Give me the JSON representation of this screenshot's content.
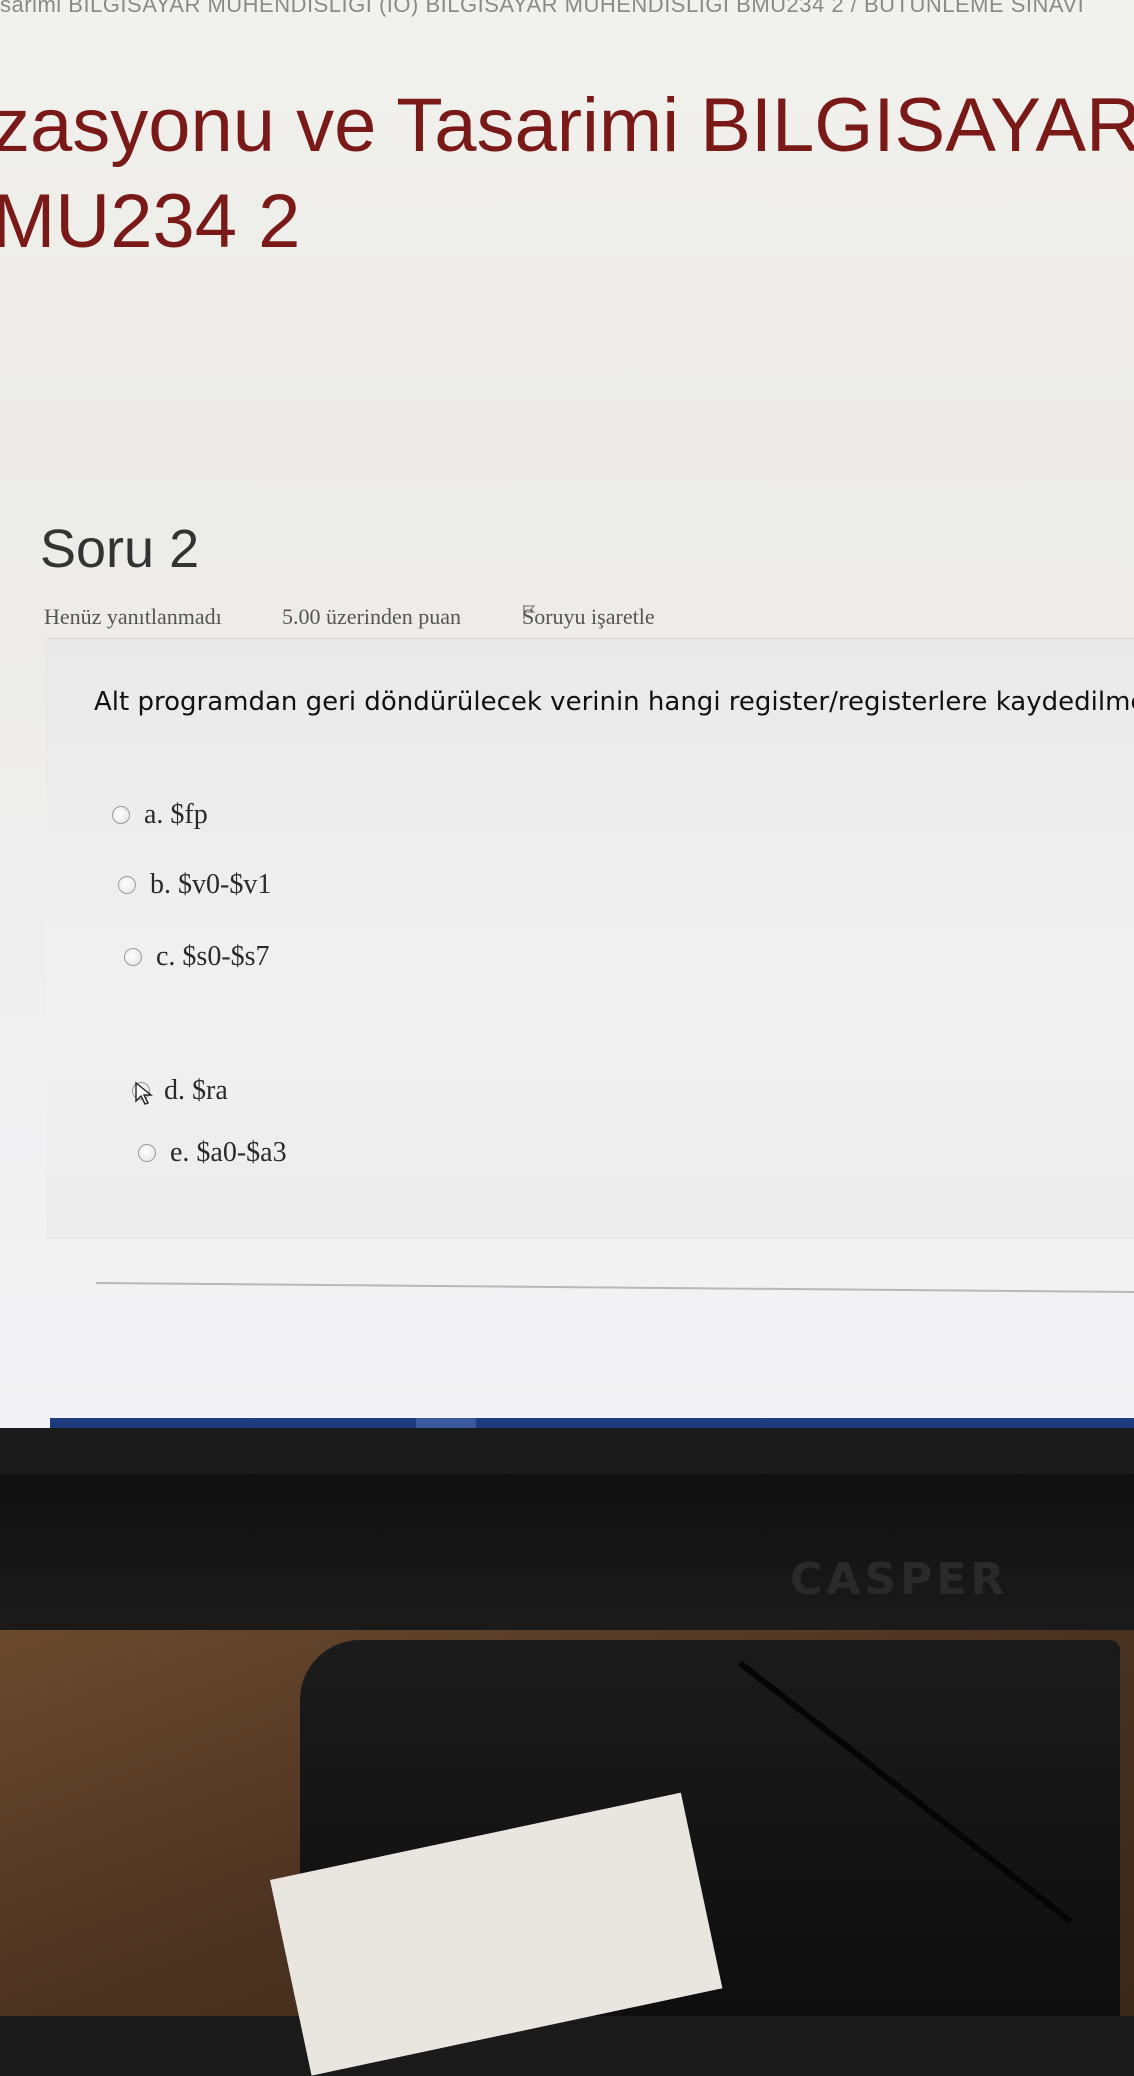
{
  "breadcrumb": {
    "text": "sarimi BILGISAYAR MUHENDISLIGI (IÖ) BILGISAYAR MUHENDISLIGI BMU234 2 / BUTUNLEME SINAVI"
  },
  "course": {
    "title_line1": "zasyonu ve Tasarimi BILGISAYAR",
    "title_line2": "MU234 2"
  },
  "question": {
    "title": "Soru 2",
    "status": "Henüz yanıtlanmadı",
    "points": "5.00 üzerinden puan",
    "flag_label": "Soruyu işaretle",
    "text": "Alt programdan geri döndürülecek verinin hangi register/registerlere kaydedilmesi g",
    "options": [
      {
        "label": "a. $fp"
      },
      {
        "label": "b. $v0-$v1"
      },
      {
        "label": "c. $s0-$s7"
      },
      {
        "label": "d. $ra"
      },
      {
        "label": "e. $a0-$a3"
      }
    ]
  },
  "taskbar": {
    "items": [
      "task-view-icon",
      "edge-icon",
      "file-explorer-icon",
      "store-icon",
      "mail-icon",
      "chrome-icon",
      "calculator-icon"
    ]
  },
  "monitor": {
    "brand": "CASPER"
  }
}
